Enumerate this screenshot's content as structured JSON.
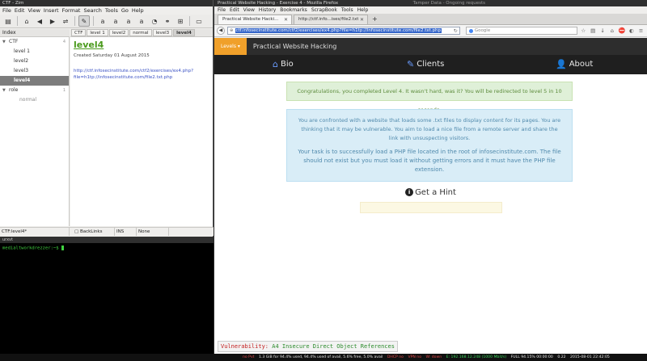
{
  "zim": {
    "title": "CTF - Zim",
    "menu": [
      "File",
      "Edit",
      "View",
      "Insert",
      "Format",
      "Search",
      "Tools",
      "Go",
      "Help"
    ],
    "index_header": "Index",
    "index": [
      {
        "label": "CTF",
        "expanded": true,
        "level": 0,
        "count": "4"
      },
      {
        "label": "level 1",
        "level": 1
      },
      {
        "label": "level2",
        "level": 1
      },
      {
        "label": "level3",
        "level": 1
      },
      {
        "label": "level4",
        "level": 1,
        "selected": true
      },
      {
        "label": "role",
        "expanded": true,
        "level": 0,
        "count": "1"
      },
      {
        "label": "normal",
        "level": 2
      }
    ],
    "pathbar": [
      "CTF",
      "level 1",
      "level2",
      "normal",
      "level3",
      "level4"
    ],
    "editor": {
      "title": "level4",
      "created": "Created Saturday 01 August 2015",
      "link": "http://ctf.infosecinstitute.com/ctf2/exercises/ex4.php?file=h1tp://infosecinstitute.com/file2.txt.php"
    },
    "status": {
      "page": "CTF:level4*",
      "backlinks": "BackLinks",
      "mode": "INS",
      "style": "None"
    }
  },
  "terminal": {
    "title": "urxvt",
    "prompt": "medialtworkdrezzer:~$"
  },
  "firefox": {
    "title": "Practical Website Hacking - Exercise 4 - Mozilla Firefox",
    "title_right": "Tamper Data - Ongoing requests",
    "menu": [
      "File",
      "Edit",
      "View",
      "History",
      "Bookmarks",
      "ScrapBook",
      "Tools",
      "Help"
    ],
    "tabs": [
      {
        "label": "Practical Website Hacki...",
        "active": true
      },
      {
        "label": "http://ctf.info...ises/file2.txt",
        "active": false
      }
    ],
    "url": "ctf.infosecinstitute.com/ctf2/exercises/ex4.php?file=h1tp://infosecinstitute.com/file2.txt.php",
    "search_placeholder": "Google"
  },
  "site": {
    "levels_label": "Levels",
    "brand": "Practical Website Hacking",
    "nav": [
      {
        "label": "Bio",
        "icon": "home-icon"
      },
      {
        "label": "Clients",
        "icon": "pencil-icon"
      },
      {
        "label": "About",
        "icon": "user-icon"
      }
    ],
    "success": "Congratulations, you completed Level 4. It wasn't hard, was it? You will be redirected to level 5 in 10 seconds.",
    "info1": "You are confronted with a website that loads some .txt files to display content for its pages. You are thinking that it may be vulnerable. You aim to load a nice file from a remote server and share the link with unsuspecting visitors.",
    "info2": "Your task is to successfully load a PHP file located in the root of infosecinstitute.com. The file should not exist but you must load it without getting errors and it must have the PHP file extension.",
    "hint": "Get a Hint",
    "vuln_label": "Vulnerability:",
    "vuln_value": "A4 Insecure Direct Object References"
  },
  "statusbar": [
    {
      "text": "no Pvt",
      "color": "red"
    },
    {
      "text": "1.3 GiB for 94.4% used, 94.4% used of avail, 5.6% free, 5.0% avail",
      "color": "white"
    },
    {
      "text": "DHCP no",
      "color": "red"
    },
    {
      "text": "VPN no",
      "color": "red"
    },
    {
      "text": "W: down",
      "color": "red"
    },
    {
      "text": "E: 192.168.12.248 (1000 Mbit/s)",
      "color": "green"
    },
    {
      "text": "FULL 94.15% 00:00:00",
      "color": "white"
    },
    {
      "text": "0.22",
      "color": "white"
    },
    {
      "text": "2015-08-01 22:42:05",
      "color": "white"
    }
  ]
}
